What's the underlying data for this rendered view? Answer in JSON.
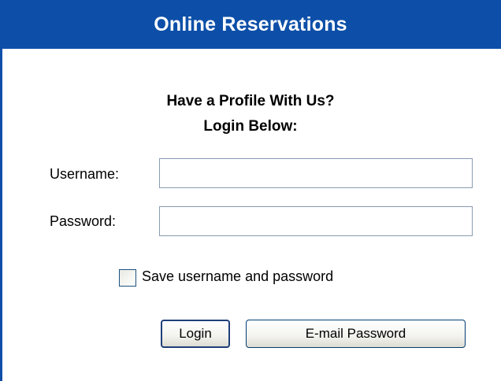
{
  "header": {
    "title": "Online Reservations"
  },
  "login_prompt": {
    "line1": "Have a Profile With Us?",
    "line2": "Login Below:"
  },
  "form": {
    "username_label": "Username:",
    "username_value": "",
    "password_label": "Password:",
    "password_value": "",
    "save_label": "Save username and password",
    "save_checked": false
  },
  "buttons": {
    "login_label": "Login",
    "email_password_label": "E-mail Password"
  },
  "colors": {
    "header_bg": "#0d4fa8",
    "header_text": "#ffffff"
  }
}
